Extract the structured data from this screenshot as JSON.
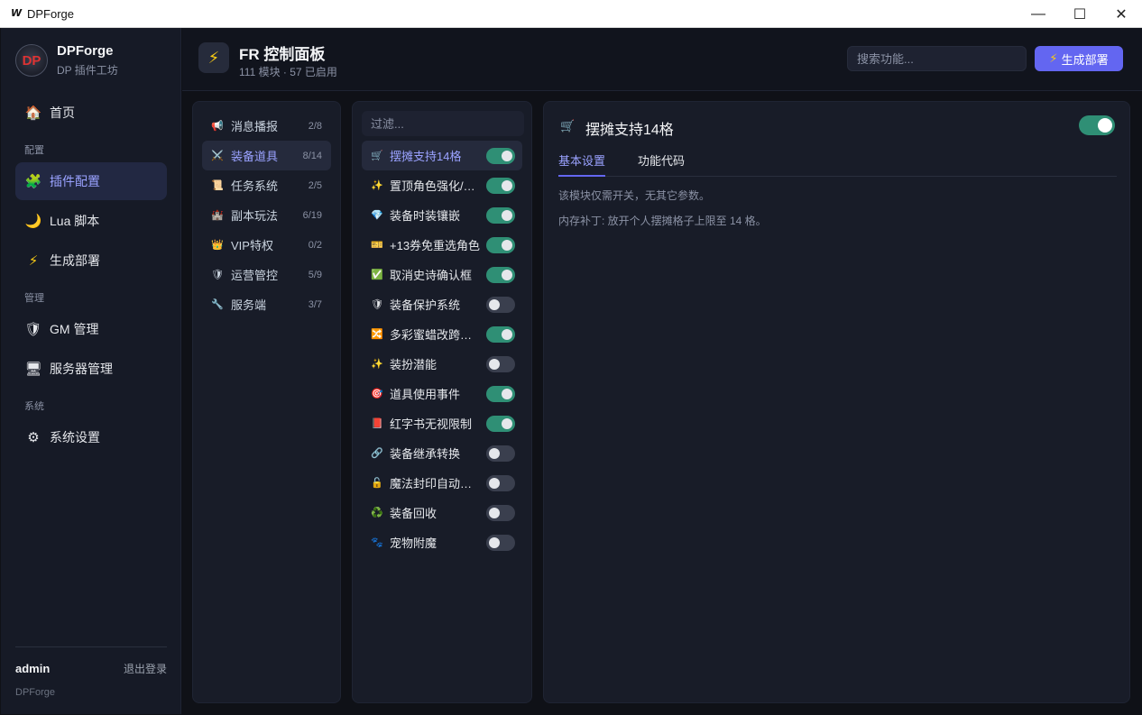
{
  "window": {
    "title": "DPForge",
    "app_icon": "W"
  },
  "brand": {
    "name": "DPForge",
    "subtitle": "DP 插件工坊",
    "logo_text": "DP"
  },
  "nav": {
    "home": "首页",
    "sec_config": "配置",
    "plugin_config": "插件配置",
    "lua": "Lua 脚本",
    "deploy": "生成部署",
    "sec_manage": "管理",
    "gm": "GM 管理",
    "server": "服务器管理",
    "sec_system": "系统",
    "settings": "系统设置"
  },
  "footer": {
    "user": "admin",
    "logout": "退出登录",
    "brand": "DPForge"
  },
  "header": {
    "title": "FR 控制面板",
    "subtitle": "111 模块 · 57 已启用",
    "search_placeholder": "搜索功能...",
    "generate_label": "生成部署"
  },
  "categories": [
    {
      "label": "消息播报",
      "count": "2/8",
      "icon": "📢"
    },
    {
      "label": "装备道具",
      "count": "8/14",
      "icon": "⚔️"
    },
    {
      "label": "任务系统",
      "count": "2/5",
      "icon": "📜"
    },
    {
      "label": "副本玩法",
      "count": "6/19",
      "icon": "🏰"
    },
    {
      "label": "VIP特权",
      "count": "0/2",
      "icon": "👑"
    },
    {
      "label": "运营管控",
      "count": "5/9",
      "icon": "🛡"
    },
    {
      "label": "服务端",
      "count": "3/7",
      "icon": "🔧"
    }
  ],
  "filter_placeholder": "过滤...",
  "modules": [
    {
      "label": "摆摊支持14格",
      "icon": "🛒",
      "on": true
    },
    {
      "label": "置顶角色强化/增幅",
      "icon": "✨",
      "on": true
    },
    {
      "label": "装备时装镶嵌",
      "icon": "💎",
      "on": true
    },
    {
      "label": "+13券免重选角色",
      "icon": "🎫",
      "on": true
    },
    {
      "label": "取消史诗确认框",
      "icon": "✅",
      "on": true
    },
    {
      "label": "装备保护系统",
      "icon": "🛡",
      "on": false
    },
    {
      "label": "多彩蜜蜡改跨界石",
      "icon": "🔀",
      "on": true
    },
    {
      "label": "装扮潜能",
      "icon": "✨",
      "on": false
    },
    {
      "label": "道具使用事件",
      "icon": "🎯",
      "on": true
    },
    {
      "label": "红字书无视限制",
      "icon": "📕",
      "on": true
    },
    {
      "label": "装备继承转换",
      "icon": "🔗",
      "on": false
    },
    {
      "label": "魔法封印自动解封",
      "icon": "🔓",
      "on": false
    },
    {
      "label": "装备回收",
      "icon": "♻️",
      "on": false
    },
    {
      "label": "宠物附魔",
      "icon": "🐾",
      "on": false
    }
  ],
  "detail": {
    "icon": "🛒",
    "title": "摆摊支持14格",
    "enabled": true,
    "tab_basic": "基本设置",
    "tab_code": "功能代码",
    "desc1": "该模块仅需开关，无其它参数。",
    "desc2": "内存补丁: 放开个人摆摊格子上限至 14 格。"
  },
  "colors": {
    "accent": "#6366f1",
    "toggle_on": "#2f8f75",
    "active_text": "#9aa2ff"
  }
}
